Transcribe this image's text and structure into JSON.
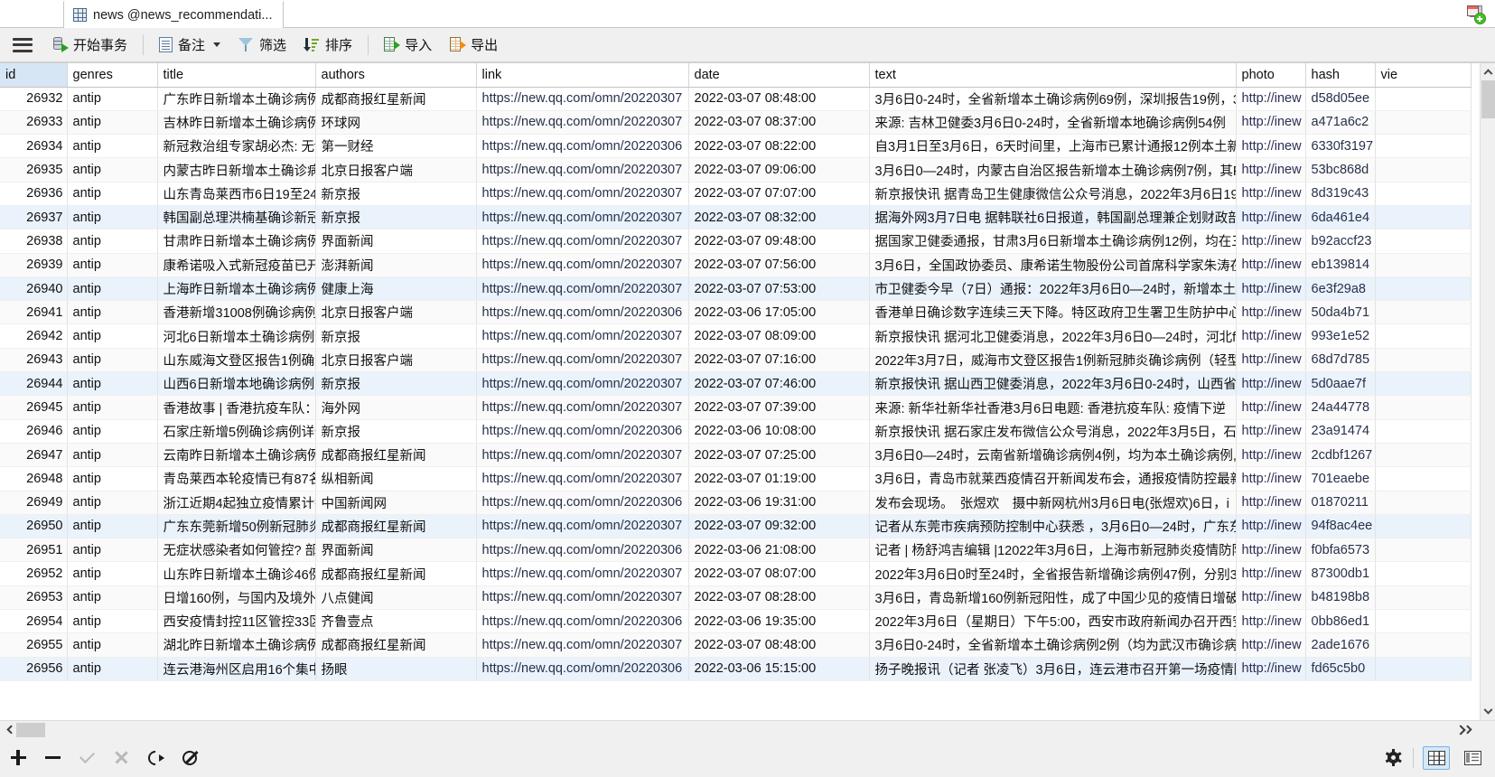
{
  "tab": {
    "label": "news @news_recommendati...",
    "icon": "table-grid-icon",
    "new_tab_icon": "new-query-icon"
  },
  "toolbar": {
    "menu_icon": "hamburger-menu-icon",
    "items": [
      {
        "label": "开始事务",
        "icon": "begin-transaction-icon",
        "name": "begin-transaction"
      },
      {
        "label": "备注",
        "icon": "note-icon",
        "name": "note",
        "has_dropdown": true
      },
      {
        "label": "筛选",
        "icon": "filter-icon",
        "name": "filter"
      },
      {
        "label": "排序",
        "icon": "sort-icon",
        "name": "sort"
      },
      {
        "label": "导入",
        "icon": "import-icon",
        "name": "import"
      },
      {
        "label": "导出",
        "icon": "export-icon",
        "name": "export"
      }
    ]
  },
  "grid": {
    "columns": [
      "id",
      "genres",
      "title",
      "authors",
      "link",
      "date",
      "text",
      "photo",
      "hash",
      "vie"
    ],
    "selected_column": "id",
    "rows": [
      {
        "id": "26932",
        "genres": "antip",
        "title": "广东昨日新增本土确诊病例6",
        "authors": "成都商报红星新闻",
        "link": "https://new.qq.com/omn/20220307",
        "date": "2022-03-07 08:48:00",
        "text": "3月6日0-24时，全省新增本土确诊病例69例，深圳报告19例，3",
        "photo": "http://inew",
        "hash": "d58d05ee",
        "view": ""
      },
      {
        "id": "26933",
        "genres": "antip",
        "title": "吉林昨日新增本土确诊病例5",
        "authors": "环球网",
        "link": "https://new.qq.com/omn/20220307",
        "date": "2022-03-07 08:37:00",
        "text": "来源: 吉林卫健委3月6日0-24时，全省新增本地确诊病例54例",
        "photo": "http://inew",
        "hash": "a471a6c2",
        "view": ""
      },
      {
        "id": "26934",
        "genres": "antip",
        "title": "新冠救治组专家胡必杰: 无f",
        "authors": "第一财经",
        "link": "https://new.qq.com/omn/20220306",
        "date": "2022-03-07 08:22:00",
        "text": "自3月1日至3月6日，6天时间里，上海市已累计通报12例本土新",
        "photo": "http://inew",
        "hash": "6330f3197",
        "view": ""
      },
      {
        "id": "26935",
        "genres": "antip",
        "title": "内蒙古昨日新增本土确诊病6",
        "authors": "北京日报客户端",
        "link": "https://new.qq.com/omn/20220307",
        "date": "2022-03-07 09:06:00",
        "text": "3月6日0—24时，内蒙古自治区报告新增本土确诊病例7例，其F",
        "photo": "http://inew",
        "hash": "53bc868d",
        "view": ""
      },
      {
        "id": "26936",
        "genres": "antip",
        "title": "山东青岛莱西市6日19至24日",
        "authors": "新京报",
        "link": "https://new.qq.com/omn/20220307",
        "date": "2022-03-07 07:07:00",
        "text": "新京报快讯 据青岛卫生健康微信公众号消息，2022年3月6日19",
        "photo": "http://inew",
        "hash": "8d319c43",
        "view": ""
      },
      {
        "id": "26937",
        "genres": "antip",
        "title": "韩国副总理洪楠基确诊新冠",
        "authors": "新京报",
        "link": "https://new.qq.com/omn/20220307",
        "date": "2022-03-07 08:32:00",
        "text": "据海外网3月7日电 据韩联社6日报道，韩国副总理兼企划财政部",
        "photo": "http://inew",
        "hash": "6da461e4",
        "view": ""
      },
      {
        "id": "26938",
        "genres": "antip",
        "title": "甘肃昨日新增本土确诊病例1",
        "authors": "界面新闻",
        "link": "https://new.qq.com/omn/20220307",
        "date": "2022-03-07 09:48:00",
        "text": "据国家卫健委通报，甘肃3月6日新增本土确诊病例12例，均在三",
        "photo": "http://inew",
        "hash": "b92accf23",
        "view": ""
      },
      {
        "id": "26939",
        "genres": "antip",
        "title": "康希诺吸入式新冠疫苗已开f",
        "authors": "澎湃新闻",
        "link": "https://new.qq.com/omn/20220307",
        "date": "2022-03-07 07:56:00",
        "text": "3月6日，全国政协委员、康希诺生物股份公司首席科学家朱涛在",
        "photo": "http://inew",
        "hash": "eb139814",
        "view": ""
      },
      {
        "id": "26940",
        "genres": "antip",
        "title": "上海昨日新增本土确诊病例3",
        "authors": "健康上海",
        "link": "https://new.qq.com/omn/20220307",
        "date": "2022-03-07 07:53:00",
        "text": "市卫健委今早（7日）通报：2022年3月6日0—24时，新增本土",
        "photo": "http://inew",
        "hash": "6e3f29a8",
        "view": ""
      },
      {
        "id": "26941",
        "genres": "antip",
        "title": "香港新增31008例确诊病例，",
        "authors": "北京日报客户端",
        "link": "https://new.qq.com/omn/20220306",
        "date": "2022-03-06 17:05:00",
        "text": "香港单日确诊数字连续三天下降。特区政府卫生署卫生防护中心",
        "photo": "http://inew",
        "hash": "50da4b71",
        "view": ""
      },
      {
        "id": "26942",
        "genres": "antip",
        "title": "河北6日新增本土确诊病例9",
        "authors": "新京报",
        "link": "https://new.qq.com/omn/20220307",
        "date": "2022-03-07 08:09:00",
        "text": "新京报快讯 据河北卫健委消息，2022年3月6日0—24时，河北f",
        "photo": "http://inew",
        "hash": "993e1e52",
        "view": ""
      },
      {
        "id": "26943",
        "genres": "antip",
        "title": "山东威海文登区报告1例确诊",
        "authors": "北京日报客户端",
        "link": "https://new.qq.com/omn/20220307",
        "date": "2022-03-07 07:16:00",
        "text": "2022年3月7日，威海市文登区报告1例新冠肺炎确诊病例（轻型",
        "photo": "http://inew",
        "hash": "68d7d785",
        "view": ""
      },
      {
        "id": "26944",
        "genres": "antip",
        "title": "山西6日新增本地确诊病例1",
        "authors": "新京报",
        "link": "https://new.qq.com/omn/20220307",
        "date": "2022-03-07 07:46:00",
        "text": "新京报快讯 据山西卫健委消息，2022年3月6日0-24时，山西省",
        "photo": "http://inew",
        "hash": "5d0aae7f",
        "view": ""
      },
      {
        "id": "26945",
        "genres": "antip",
        "title": "香港故事 | 香港抗疫车队：f",
        "authors": "海外网",
        "link": "https://new.qq.com/omn/20220307",
        "date": "2022-03-07 07:39:00",
        "text": "来源: 新华社新华社香港3月6日电题: 香港抗疫车队: 疫情下逆",
        "photo": "http://inew",
        "hash": "24a44778",
        "view": ""
      },
      {
        "id": "26946",
        "genres": "antip",
        "title": "石家庄新增5例确诊病例详情",
        "authors": "新京报",
        "link": "https://new.qq.com/omn/20220306",
        "date": "2022-03-06 10:08:00",
        "text": "新京报快讯 据石家庄发布微信公众号消息，2022年3月5日，石",
        "photo": "http://inew",
        "hash": "23a91474",
        "view": ""
      },
      {
        "id": "26947",
        "genres": "antip",
        "title": "云南昨日新增本土确诊病例4",
        "authors": "成都商报红星新闻",
        "link": "https://new.qq.com/omn/20220307",
        "date": "2022-03-07 07:25:00",
        "text": "3月6日0—24时，云南省新增确诊病例4例，均为本土确诊病例,",
        "photo": "http://inew",
        "hash": "2cdbf1267",
        "view": ""
      },
      {
        "id": "26948",
        "genres": "antip",
        "title": "青岛莱西本轮疫情已有87名!",
        "authors": "纵相新闻",
        "link": "https://new.qq.com/omn/20220307",
        "date": "2022-03-07 01:19:00",
        "text": "3月6日，青岛市就莱西疫情召开新闻发布会，通报疫情防控最新",
        "photo": "http://inew",
        "hash": "701eaebe",
        "view": ""
      },
      {
        "id": "26949",
        "genres": "antip",
        "title": "浙江近期4起独立疫情累计报",
        "authors": "中国新闻网",
        "link": "https://new.qq.com/omn/20220306",
        "date": "2022-03-06 19:31:00",
        "text": "发布会现场。　张煜欢　摄中新网杭州3月6日电(张煜欢)6日，i",
        "photo": "http://inew",
        "hash": "01870211",
        "view": ""
      },
      {
        "id": "26950",
        "genres": "antip",
        "title": "广东东莞新增50例新冠肺炎i",
        "authors": "成都商报红星新闻",
        "link": "https://new.qq.com/omn/20220307",
        "date": "2022-03-07 09:32:00",
        "text": "记者从东莞市疾病预防控制中心获悉 ，3月6日0—24时，广东东",
        "photo": "http://inew",
        "hash": "94f8ac4ee",
        "view": ""
      },
      {
        "id": "26951",
        "genres": "antip",
        "title": "无症状感染者如何管控? 部s",
        "authors": "界面新闻",
        "link": "https://new.qq.com/omn/20220306",
        "date": "2022-03-06 21:08:00",
        "text": "记者 | 杨舒鸿吉编辑 |12022年3月6日，上海市新冠肺炎疫情防阼",
        "photo": "http://inew",
        "hash": "f0bfa6573",
        "view": ""
      },
      {
        "id": "26952",
        "genres": "antip",
        "title": "山东昨日新增本土确诊46例.",
        "authors": "成都商报红星新闻",
        "link": "https://new.qq.com/omn/20220307",
        "date": "2022-03-07 08:07:00",
        "text": "2022年3月6日0时至24时，全省报告新增确诊病例47例，分别3",
        "photo": "http://inew",
        "hash": "87300db1",
        "view": ""
      },
      {
        "id": "26953",
        "genres": "antip",
        "title": "日增160例，与国内及境外报",
        "authors": "八点健闻",
        "link": "https://new.qq.com/omn/20220307",
        "date": "2022-03-07 08:28:00",
        "text": "3月6日，青岛新增160例新冠阳性，成了中国少见的疫情日增破",
        "photo": "http://inew",
        "hash": "b48198b8",
        "view": ""
      },
      {
        "id": "26954",
        "genres": "antip",
        "title": "西安疫情封控11区管控33区",
        "authors": "齐鲁壹点",
        "link": "https://new.qq.com/omn/20220306",
        "date": "2022-03-06 19:35:00",
        "text": "2022年3月6日（星期日）下午5:00，西安市政府新闻办召开西安",
        "photo": "http://inew",
        "hash": "0bb86ed1",
        "view": ""
      },
      {
        "id": "26955",
        "genres": "antip",
        "title": "湖北昨日新增本土确诊病例2",
        "authors": "成都商报红星新闻",
        "link": "https://new.qq.com/omn/20220307",
        "date": "2022-03-07 08:48:00",
        "text": "3月6日0-24时，全省新增本土确诊病例2例（均为武汉市确诊病",
        "photo": "http://inew",
        "hash": "2ade1676",
        "view": ""
      },
      {
        "id": "26956",
        "genres": "antip",
        "title": "连云港海州区启用16个集中!",
        "authors": "扬眼",
        "link": "https://new.qq.com/omn/20220306",
        "date": "2022-03-06 15:15:00",
        "text": "扬子晚报讯（记者 张凌飞）3月6日，连云港市召开第一场疫情防",
        "photo": "http://inew",
        "hash": "fd65c5b0",
        "view": ""
      }
    ],
    "highlighted_rows": [
      6,
      9,
      13,
      19,
      25
    ]
  },
  "statusbar": {
    "buttons": [
      {
        "name": "add-record",
        "icon": "plus-icon",
        "enabled": true
      },
      {
        "name": "delete-record",
        "icon": "minus-icon",
        "enabled": true
      },
      {
        "name": "apply-change",
        "icon": "check-icon",
        "enabled": false
      },
      {
        "name": "cancel-change",
        "icon": "cross-icon",
        "enabled": false
      },
      {
        "name": "refresh",
        "icon": "refresh-icon",
        "enabled": true
      },
      {
        "name": "stop",
        "icon": "stop-icon",
        "enabled": true
      }
    ],
    "right": {
      "settings_icon": "gear-icon",
      "grid_view_icon": "grid-view-icon",
      "form_view_icon": "form-view-icon",
      "active_view": "grid-view-icon"
    }
  }
}
